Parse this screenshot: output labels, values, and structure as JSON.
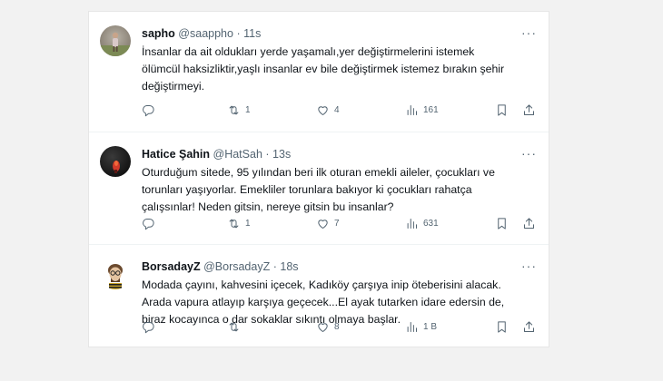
{
  "tweets": [
    {
      "name": "sapho",
      "handle": "@saappho",
      "dot": "·",
      "time": "11s",
      "text_lines": [
        "İnsanlar da ait oldukları yerde yaşamalı,yer değiştirmelerini istemek",
        "ölümcül haksizliktir,yaşlı insanlar ev bile değiştirmek istemez bırakın şehir",
        "değiştirmeyi."
      ],
      "reply_count": "",
      "retweet_count": "1",
      "like_count": "4",
      "view_count": "161"
    },
    {
      "name": "Hatice Şahin",
      "handle": "@HatSah",
      "dot": "·",
      "time": "13s",
      "text_lines": [
        "Oturduğum sitede, 95 yılından beri ilk oturan emekli aileler, çocukları ve",
        "torunları yaşıyorlar. Emekliler torunlara bakıyor ki çocukları rahatça",
        "çalışsınlar! Neden gitsin, nereye gitsin bu insanlar?"
      ],
      "reply_count": "",
      "retweet_count": "1",
      "like_count": "7",
      "view_count": "631"
    },
    {
      "name": "BorsadayZ",
      "handle": "@BorsadayZ",
      "dot": "·",
      "time": "18s",
      "text_lines": [
        "Modada çayını, kahvesini içecek, Kadıköy çarşıya inip öteberisini alacak.",
        "Arada vapura atlayıp karşıya geçecek...El ayak tutarken idare edersin de,",
        "biraz kocayınca o dar sokaklar sıkıntı olmaya başlar."
      ],
      "reply_count": "",
      "retweet_count": "",
      "like_count": "8",
      "view_count": "1 B"
    }
  ],
  "more_glyph": "···",
  "icons": {
    "reply": "reply-icon",
    "retweet": "retweet-icon",
    "like": "heart-icon",
    "views": "views-icon",
    "bookmark": "bookmark-icon",
    "share": "share-icon",
    "more": "more-icon"
  }
}
